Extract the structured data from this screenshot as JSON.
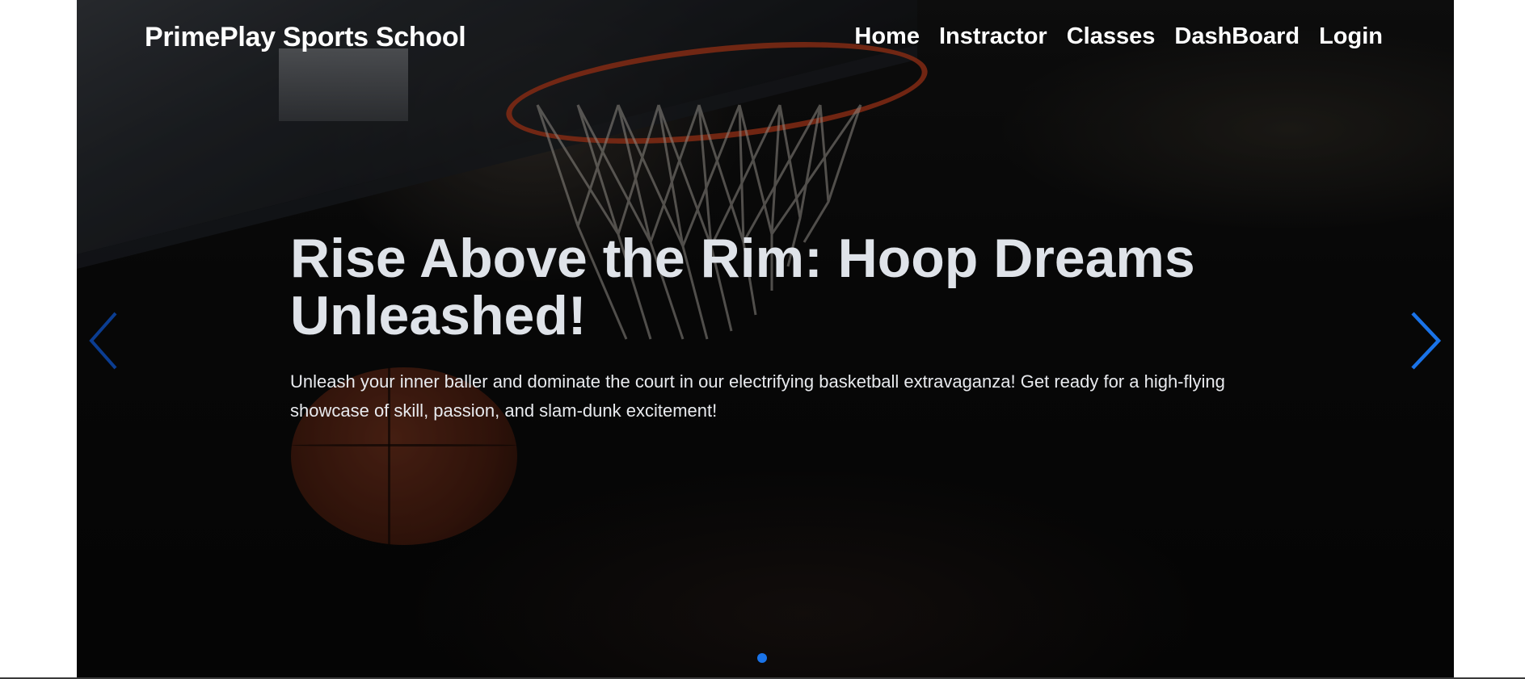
{
  "brand": {
    "name": "PrimePlay Sports School"
  },
  "nav": {
    "items": [
      {
        "label": "Home"
      },
      {
        "label": "Instractor"
      },
      {
        "label": "Classes"
      },
      {
        "label": "DashBoard"
      },
      {
        "label": "Login"
      }
    ]
  },
  "hero": {
    "headline": "Rise Above the Rim: Hoop Dreams Unleashed!",
    "description": "Unleash your inner baller and dominate the court in our electrifying basketball extravaganza! Get ready for a high-flying showcase of skill, passion, and slam-dunk excitement!",
    "background_image": "basketball-hoop-photo",
    "prev_icon": "chevron-left-icon",
    "next_icon": "chevron-right-icon"
  },
  "carousel": {
    "slide_count": 1,
    "active_index": 0
  },
  "colors": {
    "accent": "#1a73e8",
    "text": "#ffffff",
    "headline": "#dfe3e9"
  }
}
